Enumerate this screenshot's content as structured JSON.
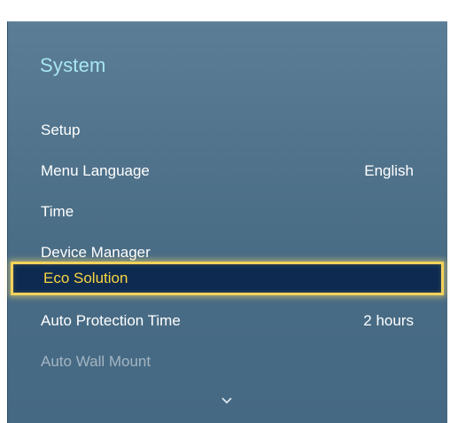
{
  "menu": {
    "title": "System",
    "items": [
      {
        "label": "Setup",
        "value": ""
      },
      {
        "label": "Menu Language",
        "value": "English"
      },
      {
        "label": "Time",
        "value": ""
      },
      {
        "label": "Device Manager",
        "value": ""
      },
      {
        "label": "Eco Solution",
        "value": "",
        "selected": true
      },
      {
        "label": "Auto Protection Time",
        "value": "2 hours"
      },
      {
        "label": "Auto Wall Mount",
        "value": "",
        "disabled": true
      }
    ]
  },
  "colors": {
    "panel": "#4e7189",
    "title": "#a8e6f2",
    "highlight_border": "#f2d25a",
    "highlight_fill": "#0e2a50",
    "highlight_text": "#f7d640"
  },
  "icons": {
    "scroll_down": "chevron-down-icon"
  }
}
